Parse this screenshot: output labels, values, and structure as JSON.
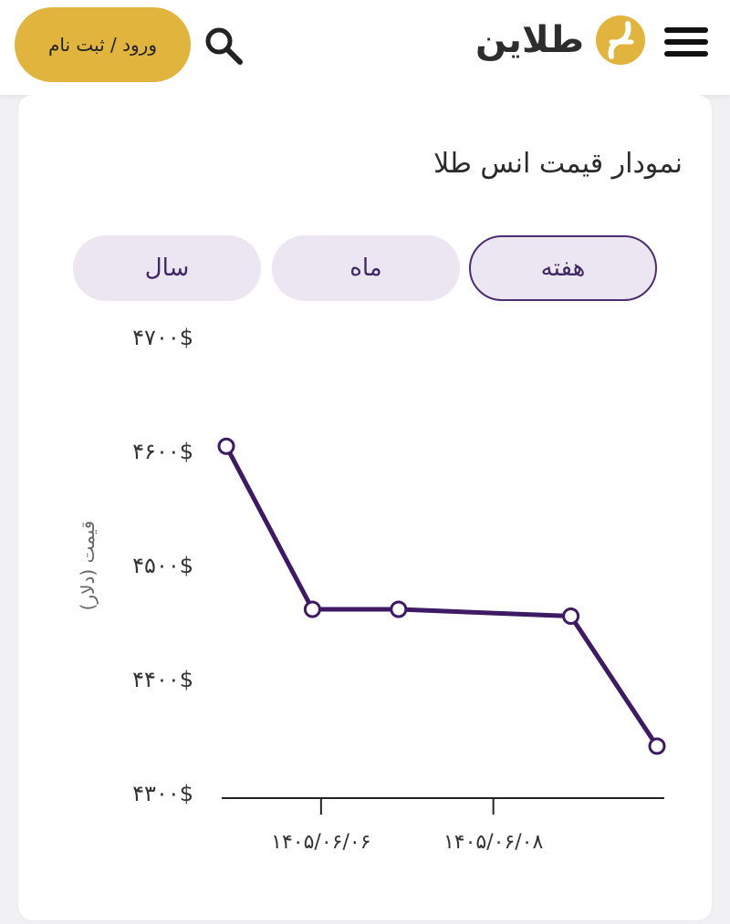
{
  "header": {
    "login_label": "ورود / ثبت نام",
    "brand_name": "طلاین",
    "icons": {
      "search": "search-icon",
      "menu": "hamburger-menu-icon",
      "logo": "talayin-logo-icon"
    },
    "accent_color": "#e1b43d"
  },
  "card": {
    "title": "نمودار قیمت انس طلا"
  },
  "tabs": [
    {
      "label": "هفته",
      "active": true
    },
    {
      "label": "ماه",
      "active": false
    },
    {
      "label": "سال",
      "active": false
    }
  ],
  "chart_data": {
    "type": "line",
    "title": "",
    "ylabel": "قیمت (دلار)",
    "xlabel": "",
    "ylim": [
      4300,
      4700
    ],
    "y_ticks": [
      "۴۷۰۰$",
      "۴۶۰۰$",
      "۴۵۰۰$",
      "۴۴۰۰$",
      "۴۳۰۰$"
    ],
    "y_tick_values": [
      4700,
      4600,
      4500,
      4400,
      4300
    ],
    "x_tick_labels": [
      "۱۴۰۵/۰۶/۰۶",
      "۱۴۰۵/۰۶/۰۸"
    ],
    "x_tick_positions": [
      1.1,
      3.1
    ],
    "x": [
      0,
      1,
      2,
      3,
      4,
      5
    ],
    "series": [
      {
        "values": [
          4603,
          4460,
          4460,
          null,
          4454,
          4340
        ]
      }
    ],
    "points": [
      {
        "x": 0,
        "y": 4603
      },
      {
        "x": 1,
        "y": 4460
      },
      {
        "x": 2,
        "y": 4460
      },
      {
        "x": 4,
        "y": 4454
      },
      {
        "x": 5,
        "y": 4340
      }
    ],
    "line_color": "#3d1a63",
    "grid": false
  }
}
